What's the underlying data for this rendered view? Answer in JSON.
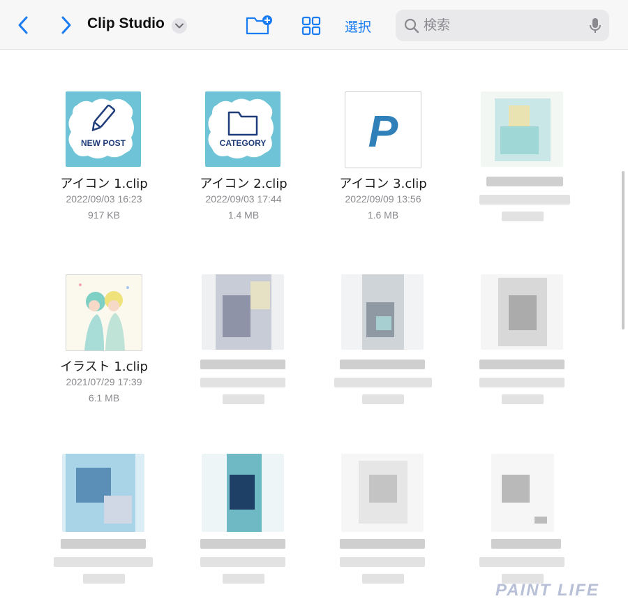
{
  "toolbar": {
    "back_icon": "chevron-left-icon",
    "forward_icon": "chevron-right-icon",
    "title": "Clip Studio",
    "title_menu_icon": "chevron-down-icon",
    "new_folder_icon": "folder-plus-icon",
    "view_icon": "grid-view-icon",
    "select_label": "選択",
    "search_placeholder": "検索",
    "accent_color": "#1a7cf2"
  },
  "files": [
    {
      "name": "アイコン 1.clip",
      "date": "2022/09/03 16:23",
      "size": "917 KB",
      "thumb_text": "NEW POST"
    },
    {
      "name": "アイコン 2.clip",
      "date": "2022/09/03 17:44",
      "size": "1.4 MB",
      "thumb_text": "CATEGORY"
    },
    {
      "name": "アイコン 3.clip",
      "date": "2022/09/09 13:56",
      "size": "1.6 MB",
      "thumb_text": "P"
    },
    {
      "name": "イラスト 1.clip",
      "date": "2021/07/29 17:39",
      "size": "6.1 MB"
    }
  ],
  "watermark": "PAINT LIFE"
}
